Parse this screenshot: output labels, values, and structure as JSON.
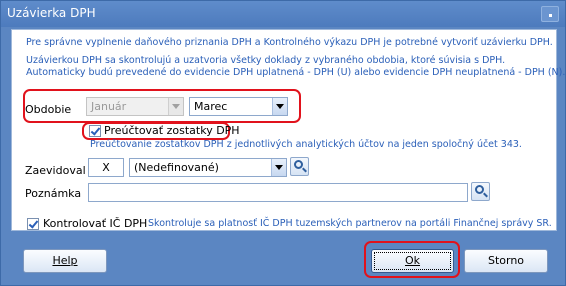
{
  "window": {
    "title": "Uzávierka DPH"
  },
  "info": {
    "line1": "Pre správne vyplnenie daňového priznania DPH a Kontrolného výkazu DPH je potrebné vytvoriť uzávierku DPH.",
    "line2": "Uzávierkou DPH sa skontrolujú a uzatvoria všetky doklady z vybraného obdobia, ktoré súvisia s DPH.",
    "line3": "Automaticky budú prevedené do evidencie DPH uplatnená - DPH (U) alebo evidencie DPH neuplatnená - DPH (N)."
  },
  "period": {
    "label": "Obdobie",
    "year_value": "Január",
    "month_value": "Marec"
  },
  "recount": {
    "label": "Preúčtovať zostatky DPH",
    "checked": true,
    "hint": "Preúčtovanie zostatkov DPH z jednotlivých analytických účtov na jeden spoločný účet 343."
  },
  "recorded_by": {
    "label": "Zaevidoval",
    "code": "X",
    "name": "(Nedefinované)"
  },
  "note": {
    "label": "Poznámka",
    "value": ""
  },
  "check_vat_id": {
    "label": "Kontrolovať IČ DPH",
    "checked": true,
    "hint": "Skontroluje sa platnosť IČ DPH tuzemských partnerov na portáli Finančnej správy SR."
  },
  "buttons": {
    "help": "Help",
    "ok": "Ok",
    "cancel": "Storno"
  },
  "colors": {
    "accent": "#2a5fb8",
    "frame": "#5b86c2",
    "highlight": "#e1121c"
  }
}
